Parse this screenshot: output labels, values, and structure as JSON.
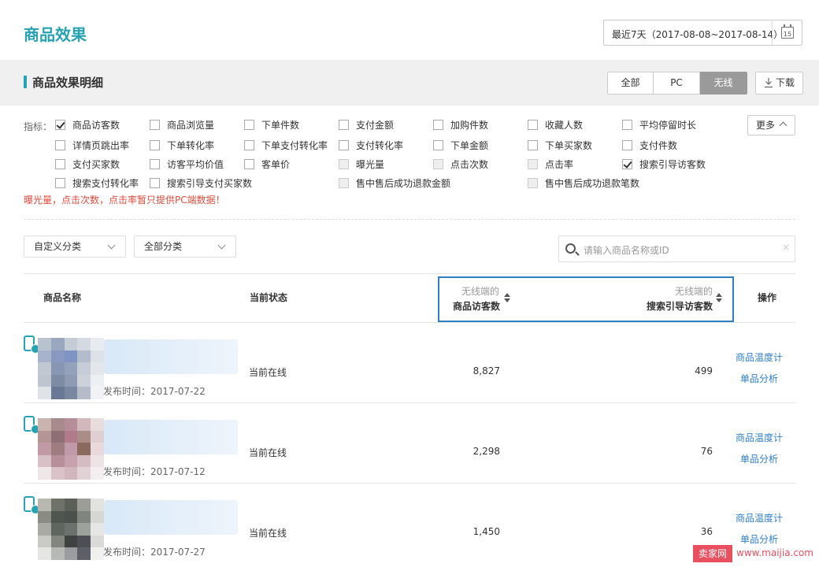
{
  "header": {
    "title": "商品效果",
    "date_range": "最近7天（2017-08-08~2017-08-14）",
    "calendar_day": "15"
  },
  "section": {
    "title": "商品效果明细",
    "segments": [
      "全部",
      "PC",
      "无线"
    ],
    "download_label": "下载"
  },
  "filters": {
    "label": "指标：",
    "more_label": "更多",
    "warning": "曝光量，点击次数，点击率暂只提供PC端数据！",
    "items": [
      {
        "label": "商品访客数",
        "checked": true,
        "disabled": false
      },
      {
        "label": "商品浏览量",
        "checked": false,
        "disabled": false
      },
      {
        "label": "下单件数",
        "checked": false,
        "disabled": false
      },
      {
        "label": "支付金额",
        "checked": false,
        "disabled": false
      },
      {
        "label": "加购件数",
        "checked": false,
        "disabled": false
      },
      {
        "label": "收藏人数",
        "checked": false,
        "disabled": false
      },
      {
        "label": "平均停留时长",
        "checked": false,
        "disabled": false
      },
      {
        "label": "详情页跳出率",
        "checked": false,
        "disabled": false
      },
      {
        "label": "下单转化率",
        "checked": false,
        "disabled": false
      },
      {
        "label": "下单支付转化率",
        "checked": false,
        "disabled": false
      },
      {
        "label": "支付转化率",
        "checked": false,
        "disabled": false
      },
      {
        "label": "下单金额",
        "checked": false,
        "disabled": false
      },
      {
        "label": "下单买家数",
        "checked": false,
        "disabled": false
      },
      {
        "label": "支付件数",
        "checked": false,
        "disabled": false
      },
      {
        "label": "支付买家数",
        "checked": false,
        "disabled": false
      },
      {
        "label": "访客平均价值",
        "checked": false,
        "disabled": false
      },
      {
        "label": "客单价",
        "checked": false,
        "disabled": false
      },
      {
        "label": "曝光量",
        "checked": false,
        "disabled": true
      },
      {
        "label": "点击次数",
        "checked": false,
        "disabled": true
      },
      {
        "label": "点击率",
        "checked": false,
        "disabled": true
      },
      {
        "label": "搜索引导访客数",
        "checked": true,
        "disabled": false
      },
      {
        "label": "搜索支付转化率",
        "checked": false,
        "disabled": false
      },
      {
        "label": "搜索引导支付买家数",
        "checked": false,
        "disabled": false
      },
      {
        "label": "售中售后成功退款金额",
        "checked": false,
        "disabled": true
      },
      {
        "label": "售中售后成功退款笔数",
        "checked": false,
        "disabled": true
      }
    ]
  },
  "toolbar": {
    "category1": "自定义分类",
    "category2": "全部分类",
    "search_placeholder": "请输入商品名称或ID",
    "search_clear": "×"
  },
  "table": {
    "col_name": "商品名称",
    "col_status": "当前状态",
    "col_visitors_sub": "无线端的",
    "col_visitors": "商品访客数",
    "col_search_sub": "无线端的",
    "col_search": "搜索引导访客数",
    "col_action": "操作",
    "rows": [
      {
        "publish": "发布时间：2017-07-22",
        "status": "当前在线",
        "visitors": "8,827",
        "search_visitors": "499",
        "action1": "商品温度计",
        "action2": "单品分析",
        "thumb_colors": [
          "#b9c2cf",
          "#9aa8bf",
          "#c6ccd6",
          "#d5dae2",
          "#e8ebf0",
          "#a6b3ca",
          "#8898c1",
          "#7f94c2",
          "#b3bccb",
          "#dde1e8",
          "#c2c8d2",
          "#8796b3",
          "#93a1ba",
          "#c7cdd7",
          "#e3e6eb",
          "#bfc5cf",
          "#7d8ba4",
          "#8e9bb2",
          "#cdd2da",
          "#edf0f3",
          "#dfe2e7",
          "#6a7896",
          "#7a87a0",
          "#b6bcc7",
          "#f0f2f5"
        ]
      },
      {
        "publish": "发布时间：2017-07-12",
        "status": "当前在线",
        "visitors": "2,298",
        "search_visitors": "76",
        "action1": "商品温度计",
        "action2": "单品分析",
        "thumb_colors": [
          "#c9b4b0",
          "#a98a8c",
          "#b68e9a",
          "#d2b8bc",
          "#e9dcdc",
          "#b49494",
          "#8e6f75",
          "#b07b8a",
          "#a98d86",
          "#e0cfd2",
          "#c19aa5",
          "#9f7c80",
          "#c19aa9",
          "#8a6a5f",
          "#e8d9dc",
          "#d8c1c6",
          "#b78f9b",
          "#c7a1ae",
          "#d4bcc2",
          "#eee3e5",
          "#efe6e8",
          "#d9c3c8",
          "#d2b6be",
          "#e2d2d6",
          "#f4eef0"
        ]
      },
      {
        "publish": "发布时间：2017-07-27",
        "status": "当前在线",
        "visitors": "1,450",
        "search_visitors": "36",
        "action1": "商品温度计",
        "action2": "单品分析",
        "thumb_colors": [
          "#b8b8b0",
          "#6e7269",
          "#5a5f58",
          "#9b9d96",
          "#e2e3df",
          "#8a8c84",
          "#4e544e",
          "#4b514d",
          "#7f847e",
          "#d6d7d3",
          "#a8aaa3",
          "#5f6660",
          "#6b716c",
          "#9ea29d",
          "#e6e7e4",
          "#c9cac5",
          "#82867f",
          "#3e4240",
          "#4d4f55",
          "#dadbd8",
          "#e5e6e3",
          "#b7b9b4",
          "#9a9ca0",
          "#5c5e68",
          "#f0f0ee"
        ]
      }
    ]
  },
  "watermark": {
    "badge": "卖家网",
    "url": "www.maijia.com"
  },
  "colors": {
    "accent": "#26a2b2",
    "link": "#2f7fc8",
    "warning": "#e24b3b",
    "highlight_border": "#2f7fc8"
  }
}
